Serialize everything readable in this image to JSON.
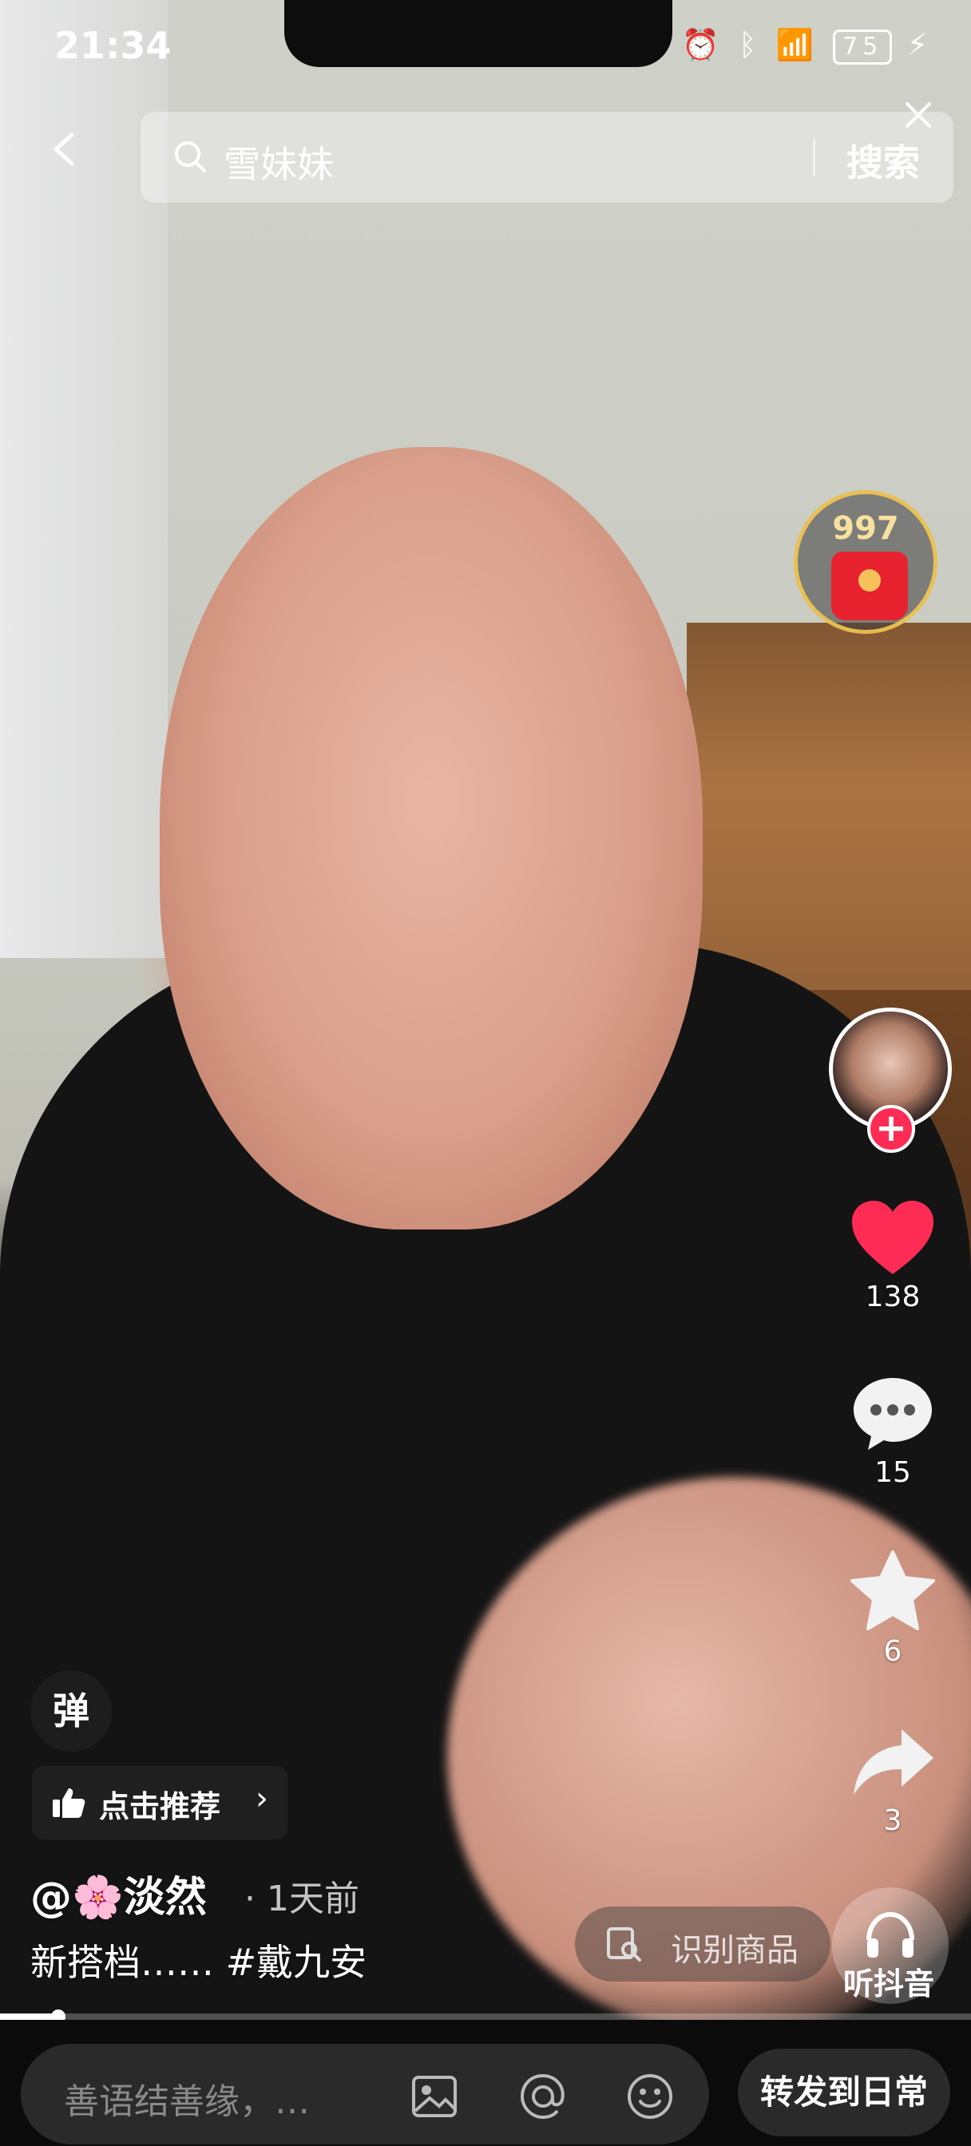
{
  "status_bar": {
    "time": "21:34",
    "battery": "75"
  },
  "search": {
    "query": "雪妹妹",
    "button_label": "搜索"
  },
  "right_rail": {
    "gift_count": "997",
    "like_count": "138",
    "comment_count": "15",
    "favorite_count": "6",
    "share_count": "3",
    "like_color": "#fe2c55"
  },
  "video": {
    "danmu_label": "弹",
    "recommend_label": "点击推荐",
    "author": "@🌸淡然",
    "time_ago": "· 1天前",
    "caption": "新搭档…… #戴九安",
    "identify_label": "识别商品",
    "listen_label": "听抖音",
    "progress": 0.06
  },
  "bottom_bar": {
    "comment_placeholder": "善语结善缘，…",
    "share_daily_label": "转发到日常"
  },
  "icons": [
    "back-icon",
    "search-icon",
    "clear-icon",
    "gift-icon",
    "heart-icon",
    "comment-icon",
    "star-icon",
    "share-icon",
    "thumbs-up-icon",
    "shopping-scan-icon",
    "headphones-icon",
    "image-icon",
    "at-icon",
    "emoji-icon"
  ]
}
